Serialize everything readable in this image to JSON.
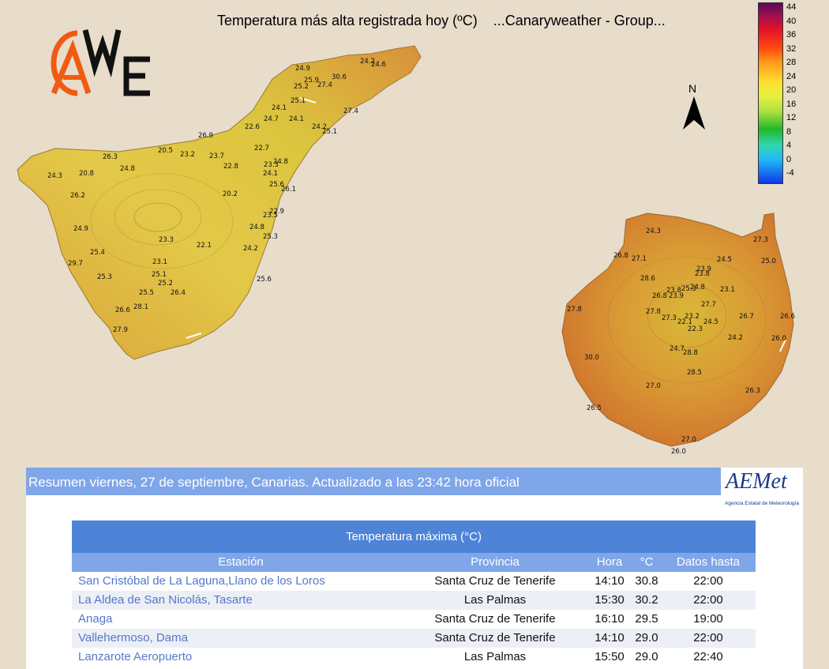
{
  "map": {
    "title": "Temperatura más alta registrada hoy (ºC)    ...Canaryweather - Group...",
    "north_label": "N",
    "scale_labels": [
      "44",
      "40",
      "36",
      "32",
      "28",
      "24",
      "20",
      "16",
      "12",
      "8",
      "4",
      "0",
      "-4"
    ],
    "tenerife_labels": [
      [
        "24.9"
      ],
      [
        "24.2"
      ],
      [
        "24.6"
      ],
      [
        "30.6"
      ],
      [
        "25.9"
      ],
      [
        "27.4"
      ],
      [
        "25.2"
      ],
      [
        "25.1"
      ],
      [
        "24.1"
      ],
      [
        "24.7"
      ],
      [
        "24.1"
      ],
      [
        "27.4"
      ],
      [
        "22.6"
      ],
      [
        "24.2"
      ],
      [
        "25.1"
      ],
      [
        "26.9"
      ],
      [
        "22.7"
      ],
      [
        "20.5"
      ],
      [
        "23.2"
      ],
      [
        "23.7"
      ],
      [
        "24.8"
      ],
      [
        "26.3"
      ],
      [
        "22.8"
      ],
      [
        "23.3"
      ],
      [
        "24.8"
      ],
      [
        "20.8"
      ],
      [
        "24.3"
      ],
      [
        "24.1"
      ],
      [
        "25.6"
      ],
      [
        "26.1"
      ],
      [
        "26.2"
      ],
      [
        "20.2"
      ],
      [
        "22.9"
      ],
      [
        "23.5"
      ],
      [
        "24.9"
      ],
      [
        "24.8"
      ],
      [
        "25.3"
      ],
      [
        "23.3"
      ],
      [
        "22.1"
      ],
      [
        "24.2"
      ],
      [
        "25.4"
      ],
      [
        "29.7"
      ],
      [
        "23.1"
      ],
      [
        "25.1"
      ],
      [
        "25.3"
      ],
      [
        "25.2"
      ],
      [
        "25.6"
      ],
      [
        "25.5"
      ],
      [
        "26.4"
      ],
      [
        "26.6"
      ],
      [
        "28.1"
      ],
      [
        "27.9"
      ]
    ],
    "gran_canaria_labels": [
      [
        "24.3"
      ],
      [
        "27.3"
      ],
      [
        "26.8"
      ],
      [
        "27.1"
      ],
      [
        "24.5"
      ],
      [
        "25.0"
      ],
      [
        "23.9"
      ],
      [
        "23.8"
      ],
      [
        "28.6"
      ],
      [
        "23.8"
      ],
      [
        "25.3"
      ],
      [
        "24.8"
      ],
      [
        "23.1"
      ],
      [
        "26.8"
      ],
      [
        "23.9"
      ],
      [
        "27.7"
      ],
      [
        "27.8"
      ],
      [
        "27.8"
      ],
      [
        "27.3"
      ],
      [
        "23.2"
      ],
      [
        "22.1"
      ],
      [
        "24.5"
      ],
      [
        "26.7"
      ],
      [
        "26.6"
      ],
      [
        "22.3"
      ],
      [
        "24.2"
      ],
      [
        "26.0"
      ],
      [
        "24.7"
      ],
      [
        "28.8"
      ],
      [
        "30.0"
      ],
      [
        "28.5"
      ],
      [
        "27.0"
      ],
      [
        "26.3"
      ],
      [
        "26.5"
      ],
      [
        "27.0"
      ],
      [
        "26.0"
      ]
    ]
  },
  "logo": {
    "text": "CAWE"
  },
  "summary": {
    "header": "Resumen viernes, 27 de septiembre, Canarias. Actualizado a las 23:42 hora oficial",
    "aemet_logo_text": "AEMet",
    "aemet_subtitle": "Agencia Estatal de Meteorología"
  },
  "table": {
    "title": "Temperatura máxima (°C)",
    "headers": {
      "station": "Estación",
      "province": "Provincia",
      "hour": "Hora",
      "temp": "°C",
      "until": "Datos hasta"
    },
    "rows": [
      {
        "station": "San Cristóbal de La Laguna,Llano de los Loros",
        "province": "Santa Cruz de Tenerife",
        "hour": "14:10",
        "temp": "30.8",
        "until": "22:00"
      },
      {
        "station": "La Aldea de San Nicolás, Tasarte",
        "province": "Las Palmas",
        "hour": "15:30",
        "temp": "30.2",
        "until": "22:00"
      },
      {
        "station": "Anaga",
        "province": "Santa Cruz de Tenerife",
        "hour": "16:10",
        "temp": "29.5",
        "until": "19:00"
      },
      {
        "station": "Vallehermoso, Dama",
        "province": "Santa Cruz de Tenerife",
        "hour": "14:10",
        "temp": "29.0",
        "until": "22:00"
      },
      {
        "station": "Lanzarote Aeropuerto",
        "province": "Las Palmas",
        "hour": "15:50",
        "temp": "29.0",
        "until": "22:40"
      }
    ]
  }
}
